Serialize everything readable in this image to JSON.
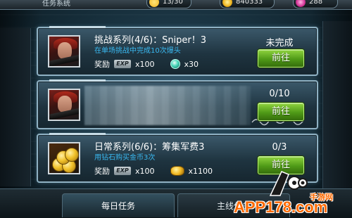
{
  "topbar": {
    "title": "任务系统",
    "resources": [
      {
        "icon": "energy-icon",
        "value": "13/30",
        "color": "#f2b31c"
      },
      {
        "icon": "gold-coin-icon",
        "value": "840333",
        "color": "#f0b823"
      },
      {
        "icon": "gem-icon",
        "value": "288",
        "color": "#d63a9b"
      }
    ]
  },
  "quests": [
    {
      "title": "挑战系列(4/6)：Sniper！3",
      "description": "在单场挑战中完成10次爆头",
      "reward_label": "奖励",
      "rewards": [
        {
          "icon": "exp-badge-icon",
          "label": "EXP",
          "amount": "x100"
        },
        {
          "icon": "gem-icon",
          "amount": "x30"
        }
      ],
      "status": "未完成",
      "button_label": "前往"
    },
    {
      "title": "",
      "description": "",
      "reward_label": "",
      "rewards": [],
      "status": "0/10",
      "button_label": "前往"
    },
    {
      "title": "日常系列(6/6)：筹集军费3",
      "description": "用钻石购买金币3次",
      "reward_label": "奖励",
      "rewards": [
        {
          "icon": "exp-badge-icon",
          "label": "EXP",
          "amount": "x100"
        },
        {
          "icon": "gold-coin-icon",
          "amount": "x1100"
        }
      ],
      "status": "0/3",
      "button_label": "前往"
    }
  ],
  "tabs": {
    "daily": "每日任务",
    "main": "主线任务"
  },
  "colors": {
    "accent_green": "#4f9a17",
    "description_blue": "#39b8f0",
    "card_border": "#8fb1c3",
    "watermark_orange": "#ff6a00"
  },
  "watermark": {
    "domain": "APP178.com",
    "sub": "手游网"
  }
}
